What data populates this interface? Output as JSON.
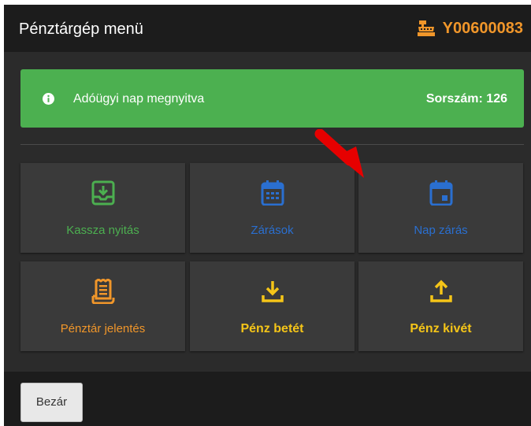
{
  "header": {
    "title": "Pénztárgép menü",
    "device_id": "Y00600083",
    "device_icon": "cash-register-icon"
  },
  "banner": {
    "message": "Adóügyi nap megnyitva",
    "serial": "Sorszám: 126",
    "icon": "info-icon"
  },
  "tiles": [
    {
      "label": "Kassza nyitás",
      "icon": "tray-download-icon",
      "color": "#4caf50"
    },
    {
      "label": "Zárások",
      "icon": "calendar-grid-icon",
      "color": "#2a6fd0"
    },
    {
      "label": "Nap zárás",
      "icon": "calendar-day-icon",
      "color": "#2a6fd0"
    },
    {
      "label": "Pénztár jelentés",
      "icon": "receipt-icon",
      "color": "#f0962a"
    },
    {
      "label": "Pénz betét",
      "icon": "download-icon",
      "color": "#f5c518"
    },
    {
      "label": "Pénz kivét",
      "icon": "upload-icon",
      "color": "#f5c518"
    }
  ],
  "footer": {
    "close_label": "Bezár"
  },
  "colors": {
    "accent": "#f0962a",
    "success": "#4cb050",
    "panel": "#2b2b2b",
    "annotation": "#e60000"
  }
}
